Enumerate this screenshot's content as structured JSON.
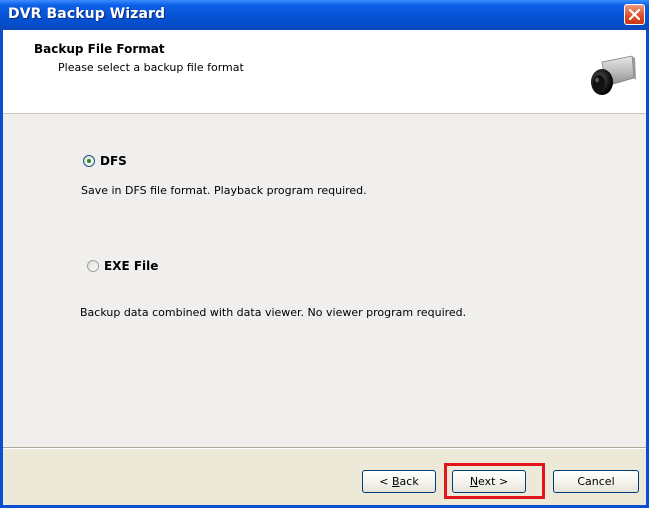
{
  "window": {
    "title": "DVR Backup Wizard",
    "close_icon": "close-icon"
  },
  "header": {
    "title": "Backup File Format",
    "subtitle": "Please select a backup file format",
    "icon": "camera-icon"
  },
  "options": [
    {
      "label": "DFS",
      "selected": true,
      "description": "Save in DFS file format. Playback program required."
    },
    {
      "label": "EXE File",
      "selected": false,
      "description": "Backup data combined with data viewer. No viewer program required."
    }
  ],
  "buttons": {
    "back_prefix": "< ",
    "back_mnemonic": "B",
    "back_rest": "ack",
    "next_mnemonic": "N",
    "next_rest": "ext >",
    "cancel": "Cancel"
  },
  "colors": {
    "titlebar": "#0753d6",
    "highlight": "#e0161d",
    "panel": "#ece9d8"
  }
}
